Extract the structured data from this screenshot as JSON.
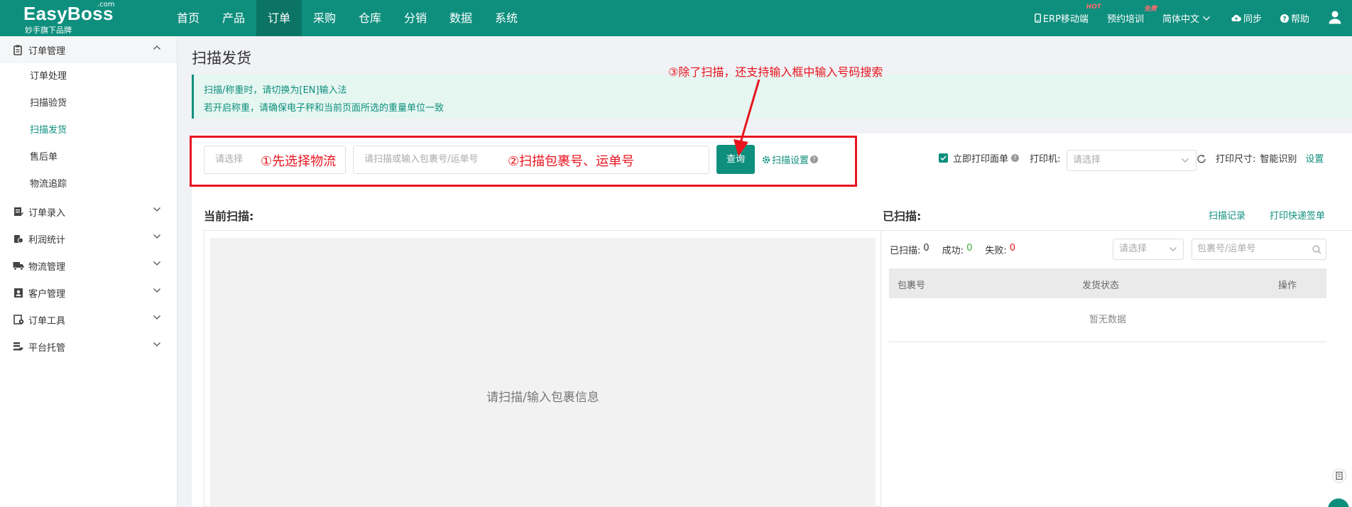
{
  "logo": {
    "brand": "EasyBoss",
    "suffix": ".com",
    "tagline": "妙手旗下品牌"
  },
  "nav": {
    "items": [
      {
        "label": "首页"
      },
      {
        "label": "产品"
      },
      {
        "label": "订单",
        "active": true
      },
      {
        "label": "采购"
      },
      {
        "label": "仓库"
      },
      {
        "label": "分销"
      },
      {
        "label": "数据"
      },
      {
        "label": "系统"
      }
    ]
  },
  "topright": {
    "erp": "ERP移动端",
    "erp_badge": "HOT",
    "training": "预约培训",
    "training_badge": "免费",
    "language": "简体中文",
    "sync": "同步",
    "help": "帮助"
  },
  "sidebar": {
    "order_mgmt": "订单管理",
    "subitems": [
      "订单处理",
      "扫描验货",
      "扫描发货",
      "售后单",
      "物流追踪"
    ],
    "groups": [
      "订单录入",
      "利润统计",
      "物流管理",
      "客户管理",
      "订单工具",
      "平台托管"
    ]
  },
  "page": {
    "title": "扫描发货",
    "notice1": "扫描/称重时，请切换为[EN]输入法",
    "notice2": "若开启称重，请确保电子秤和当前页面所选的重量单位一致"
  },
  "toolbar": {
    "logistics_placeholder": "请选择",
    "scan_placeholder": "请扫描或输入包裹号/运单号",
    "query_label": "查询",
    "scan_settings": "扫描设置",
    "print_now": "立即打印面单",
    "printer_label": "打印机:",
    "printer_placeholder": "请选择",
    "print_size_label": "打印尺寸:",
    "print_size_value": "智能识别",
    "settings_link": "设置"
  },
  "annotations": {
    "a1": "①先选择物流",
    "a2": "②扫描包裹号、运单号",
    "a3": "③除了扫描，还支持输入框中输入号码搜索"
  },
  "current": {
    "title": "当前扫描:",
    "placeholder": "请扫描/输入包裹信息"
  },
  "scanned": {
    "title": "已扫描:",
    "record_link": "扫描记录",
    "print_link": "打印快递签单",
    "count_label": "已扫描:",
    "count": "0",
    "success_label": "成功:",
    "success": "0",
    "fail_label": "失败:",
    "fail": "0",
    "filter_placeholder": "请选择",
    "search_placeholder": "包裹号/运单号",
    "col_package": "包裹号",
    "col_status": "发货状态",
    "col_action": "操作",
    "empty": "暂无数据"
  },
  "colors": {
    "primary": "#0e8f7e",
    "annotation": "#e8141e"
  }
}
